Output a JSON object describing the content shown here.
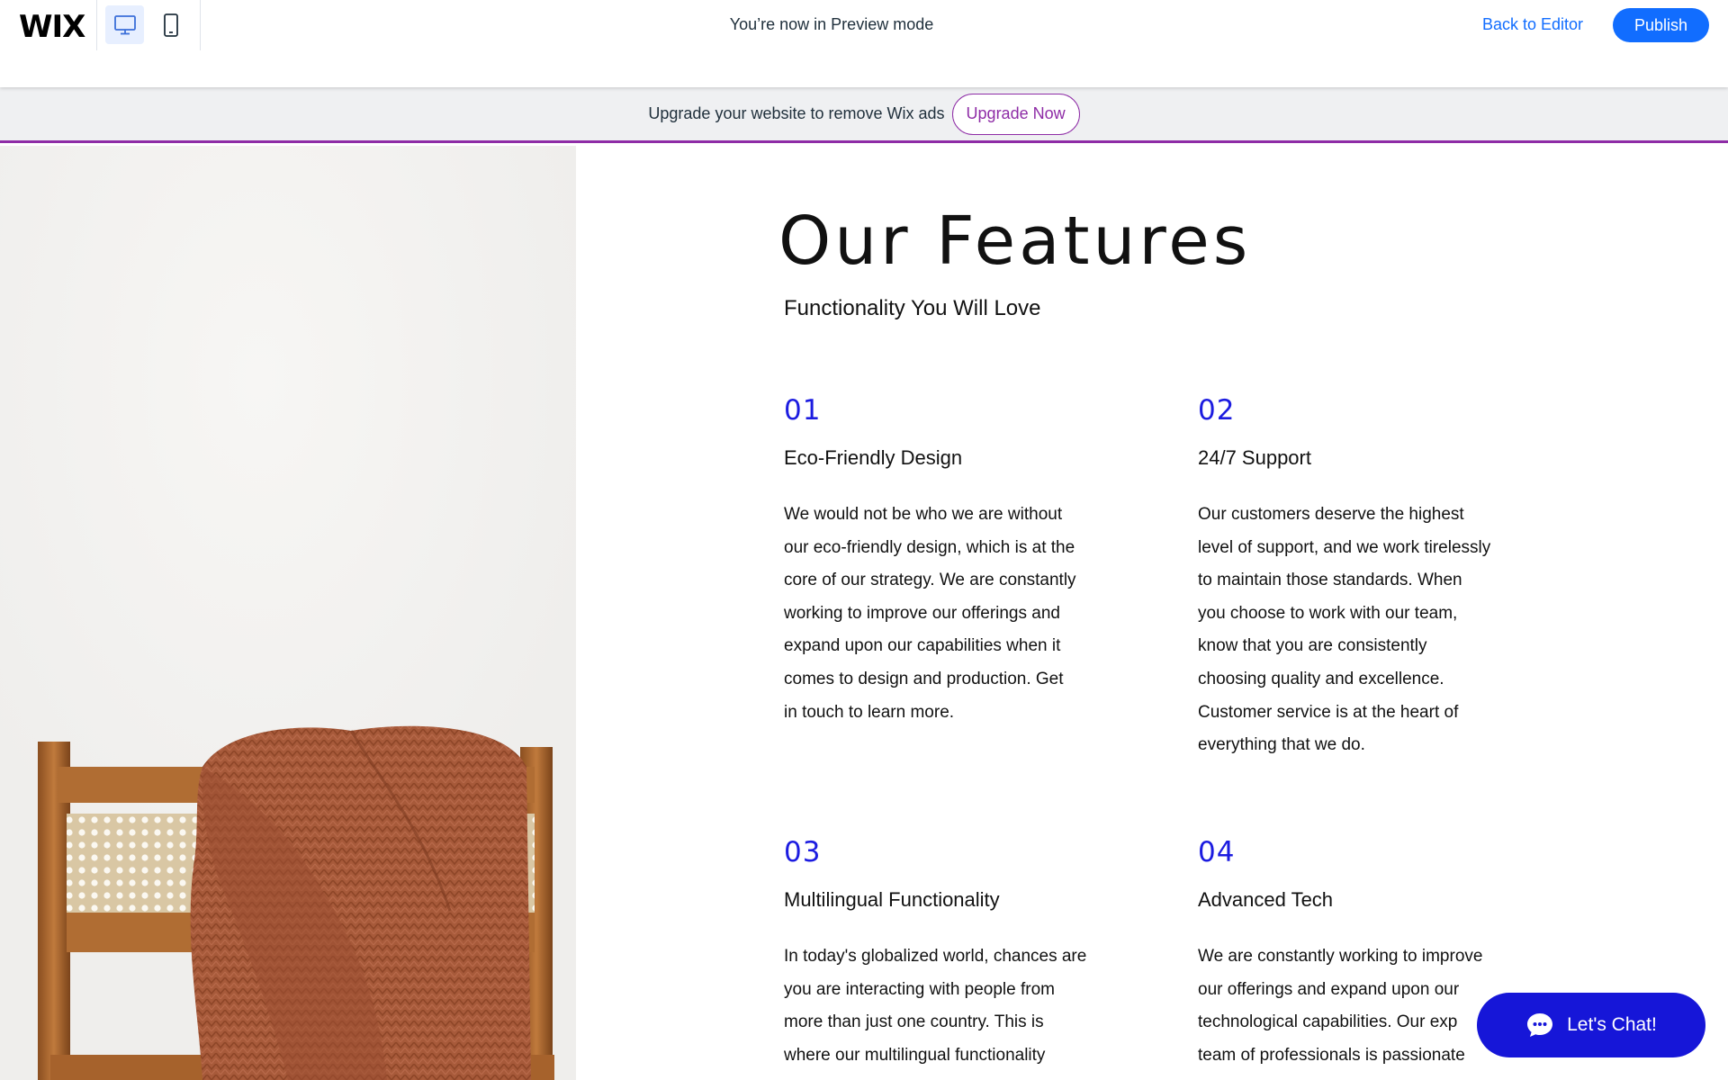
{
  "topbar": {
    "logo": "WIX",
    "preview_label": "You’re now in Preview mode",
    "back_to_editor": "Back to Editor",
    "publish": "Publish",
    "device_desktop_icon": "desktop-icon",
    "device_mobile_icon": "mobile-icon"
  },
  "upgrade": {
    "text": "Upgrade your website to remove Wix ads",
    "button": "Upgrade Now"
  },
  "page": {
    "title": "Our Features",
    "subtitle": "Functionality You Will Love",
    "features": [
      {
        "number": "01",
        "title": "Eco-Friendly Design",
        "lines": [
          "We would not be who we are without",
          "our eco-friendly design, which is at the",
          "core of our strategy. We are constantly",
          "working to improve our offerings and",
          "expand upon our capabilities when it",
          "comes to design and production. Get",
          "in touch to learn more."
        ]
      },
      {
        "number": "02",
        "title": "24/7 Support",
        "lines": [
          "Our customers deserve the highest",
          "level of support, and we work tirelessly",
          "to maintain those standards. When",
          "you choose to work with our team,",
          "know that you are consistently",
          "choosing quality and excellence.",
          "Customer service is at the heart of",
          "everything that we do."
        ]
      },
      {
        "number": "03",
        "title": "Multilingual Functionality",
        "lines": [
          "In today's globalized world, chances are",
          "you are interacting with people from",
          "more than just one country. This is",
          "where our multilingual functionality"
        ]
      },
      {
        "number": "04",
        "title": "Advanced Tech",
        "lines": [
          "We are constantly working to improve",
          "our offerings and expand upon our",
          "technological capabilities. Our exp",
          "team of professionals is passionate"
        ]
      }
    ]
  },
  "chat": {
    "label": "Let's Chat!",
    "icon": "chat-bubble-icon"
  },
  "colors": {
    "wix_blue": "#116dff",
    "upgrade_purple": "#8e2ca6",
    "feature_number": "#1c1ce0",
    "chat_bg": "#1616d8"
  }
}
